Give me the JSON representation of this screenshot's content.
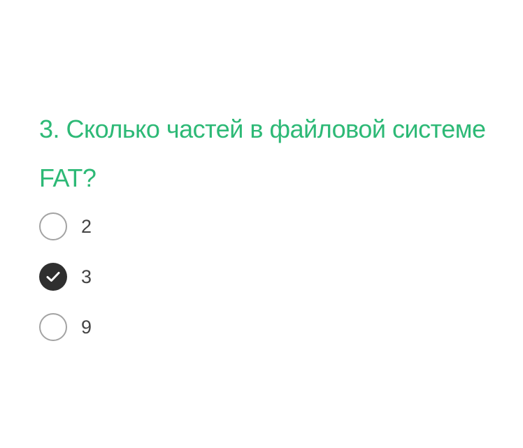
{
  "question": {
    "text": "3. Сколько частей в файловой системе FAT?"
  },
  "options": [
    {
      "label": "2",
      "selected": false
    },
    {
      "label": "3",
      "selected": true
    },
    {
      "label": "9",
      "selected": false
    }
  ],
  "colors": {
    "question_text": "#2db976",
    "checked_radio": "#2f2f2f",
    "unchecked_border": "#a3a3a3",
    "option_text": "#444444"
  },
  "icons": {
    "checked": "check-icon"
  }
}
